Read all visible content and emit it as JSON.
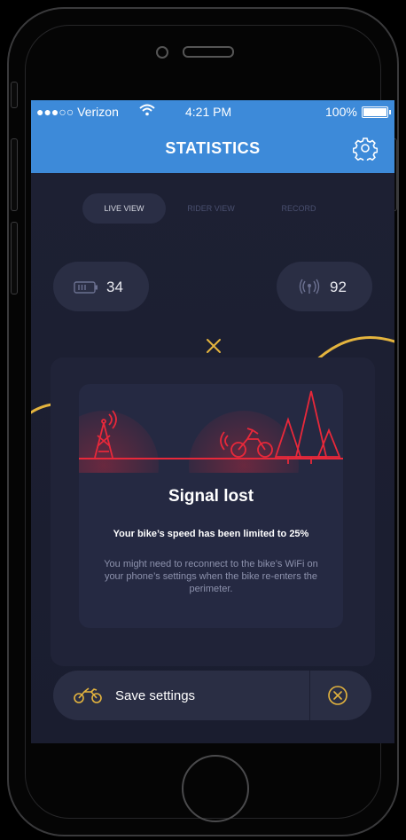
{
  "status_bar": {
    "carrier": "●●●○○ Verizon",
    "time": "4:21 PM",
    "battery_percent": "100%",
    "icons": [
      "wifi-icon",
      "battery-icon"
    ]
  },
  "header": {
    "title": "STATISTICS",
    "settings_icon": "gear-icon",
    "background_color": "#3d8ad9"
  },
  "tabs": [
    {
      "label": "LIVE VIEW",
      "active": true
    },
    {
      "label": "RIDER VIEW",
      "active": false
    },
    {
      "label": "RECORD",
      "active": false
    }
  ],
  "stats": {
    "battery": {
      "icon": "battery-icon",
      "value": "34"
    },
    "signal": {
      "icon": "signal-icon",
      "value": "92"
    }
  },
  "dialog": {
    "dismiss_icon": "close-x-icon",
    "illustration_icons": [
      "cell-tower-icon",
      "motorbike-icon",
      "trees-icon"
    ],
    "title": "Signal lost",
    "subtitle": "Your bike’s speed has been limited to 25%",
    "body": "You might need to reconnect to the bike’s WiFi on your phone’s settings when the bike re-enters the perimeter."
  },
  "bottom_bar": {
    "icon": "motorbike-icon",
    "label": "Save settings",
    "close_icon": "close-circle-icon"
  },
  "colors": {
    "accent_gold": "#e4b43e",
    "alert_red": "#e8283a",
    "screen_background": "#1b1e31"
  }
}
